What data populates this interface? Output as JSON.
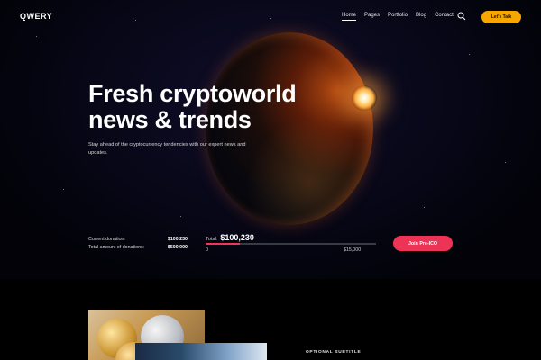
{
  "header": {
    "logo": "QWERY",
    "nav": [
      {
        "label": "Home",
        "active": true
      },
      {
        "label": "Pages",
        "active": false
      },
      {
        "label": "Portfolio",
        "active": false
      },
      {
        "label": "Blog",
        "active": false
      },
      {
        "label": "Contact",
        "active": false
      }
    ],
    "search_icon": "search-icon",
    "cta_label": "Let's Talk"
  },
  "hero": {
    "headline_line1": "Fresh cryptoworld",
    "headline_line2": "news & trends",
    "subtext": "Stay ahead of the cryptocurrency tendencies with our expert news and updates."
  },
  "donations": {
    "current_label": "Current donation:",
    "current_value": "$100,230",
    "total_label": "Total amount of donations:",
    "total_value": "$500,000"
  },
  "progress": {
    "total_label": "Total:",
    "total_value": "$100,230",
    "min_label": "0",
    "max_label": "$15,000",
    "fraction": 0.2
  },
  "join_button": "Join Pre-ICO",
  "section": {
    "subtitle": "OPTIONAL SUBTITLE"
  },
  "colors": {
    "accent_yellow": "#f7a600",
    "accent_red": "#ee3456"
  }
}
